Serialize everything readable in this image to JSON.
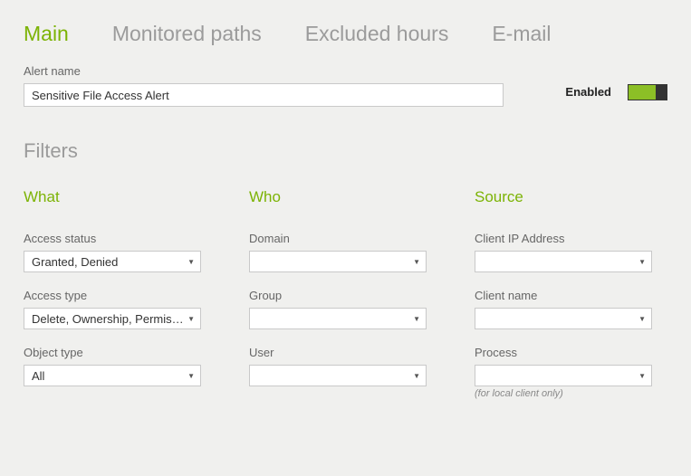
{
  "tabs": {
    "main": "Main",
    "monitored": "Monitored paths",
    "excluded": "Excluded hours",
    "email": "E-mail"
  },
  "alert": {
    "label": "Alert name",
    "value": "Sensitive File Access Alert",
    "enabled_label": "Enabled"
  },
  "filters_title": "Filters",
  "what": {
    "heading": "What",
    "access_status": {
      "label": "Access status",
      "value": "Granted, Denied"
    },
    "access_type": {
      "label": "Access type",
      "value": "Delete, Ownership, Permissi…"
    },
    "object_type": {
      "label": "Object type",
      "value": "All"
    }
  },
  "who": {
    "heading": "Who",
    "domain": {
      "label": "Domain",
      "value": ""
    },
    "group": {
      "label": "Group",
      "value": ""
    },
    "user": {
      "label": "User",
      "value": ""
    }
  },
  "source": {
    "heading": "Source",
    "client_ip": {
      "label": "Client IP Address",
      "value": ""
    },
    "client_name": {
      "label": "Client name",
      "value": ""
    },
    "process": {
      "label": "Process",
      "value": "",
      "hint": "(for local client only)"
    }
  }
}
